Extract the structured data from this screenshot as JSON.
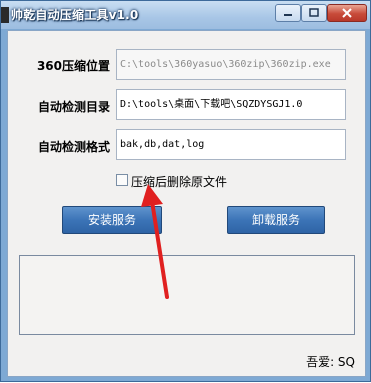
{
  "window": {
    "title": "帅乾自动压缩工具v1.0",
    "controls": {
      "minimize": "minimize",
      "maximize": "maximize",
      "close": "close"
    }
  },
  "form": {
    "fields": [
      {
        "label": "360压缩位置",
        "value": "C:\\tools\\360yasuo\\360zip\\360zip.exe",
        "enabled": false
      },
      {
        "label": "自动检测目录",
        "value": "D:\\tools\\桌面\\下载吧\\SQZDYSGJ1.0",
        "enabled": true
      },
      {
        "label": "自动检测格式",
        "value": "bak,db,dat,log",
        "enabled": true
      }
    ],
    "delete_original": {
      "label": "压缩后删除原文件",
      "checked": false
    }
  },
  "buttons": {
    "install": "安装服务",
    "uninstall": "卸载服务"
  },
  "log": {
    "text": ""
  },
  "footer": {
    "author": "吾爱: SQ"
  },
  "colors": {
    "titlebar": "#a8c6e6",
    "button": "#3c74b7",
    "annotation_arrow": "#e02020"
  }
}
